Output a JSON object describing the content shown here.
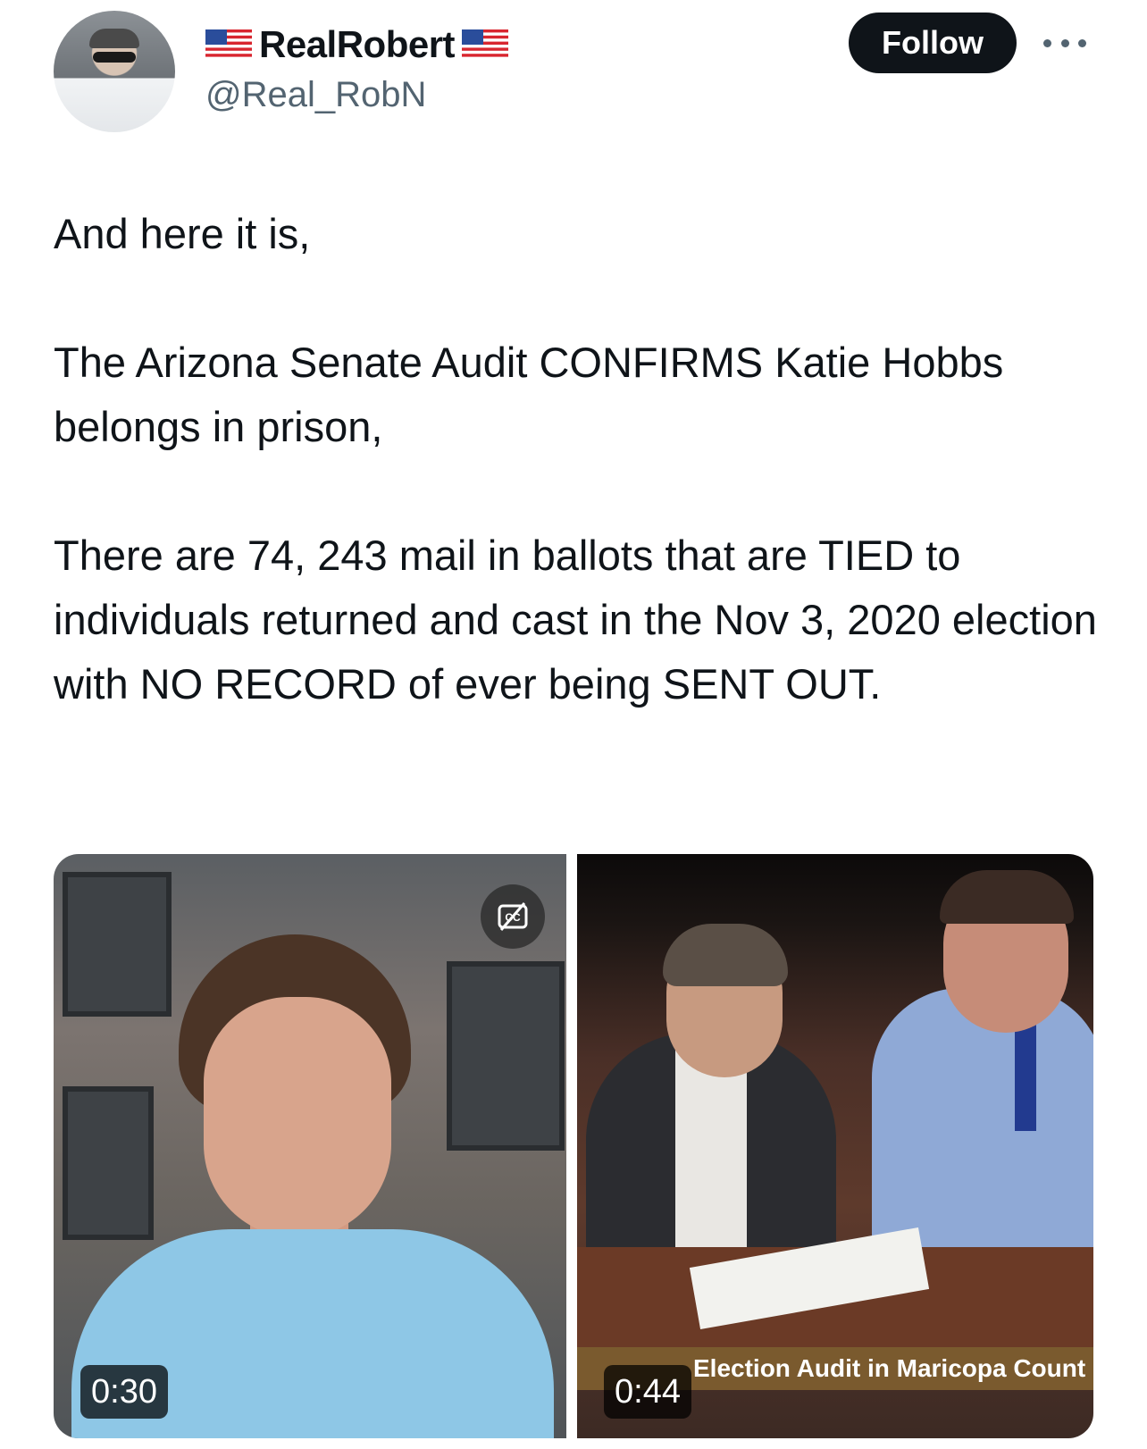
{
  "author": {
    "display_name": "RealRobert",
    "handle": "@Real_RobN",
    "avatar_icon": "profile-photo",
    "name_decoration_icon": "us-flag-emoji"
  },
  "actions": {
    "follow_label": "Follow",
    "more_icon": "more-horizontal-icon"
  },
  "tweet": {
    "paragraphs": [
      "And here it is,",
      "The Arizona Senate Audit CONFIRMS Katie Hobbs belongs in prison,",
      "There are 74, 243 mail in ballots that are TIED to individuals returned and cast  in the Nov 3, 2020 election with NO RECORD of ever being SENT OUT."
    ]
  },
  "media": [
    {
      "type": "video",
      "duration": "0:30",
      "has_captions_icon": true
    },
    {
      "type": "video",
      "duration": "0:44",
      "overlay_text": "Election Audit in Maricopa Count"
    }
  ],
  "colors": {
    "text_primary": "#0f1419",
    "text_secondary": "#536471",
    "follow_bg": "#0f1419",
    "follow_text": "#ffffff"
  }
}
